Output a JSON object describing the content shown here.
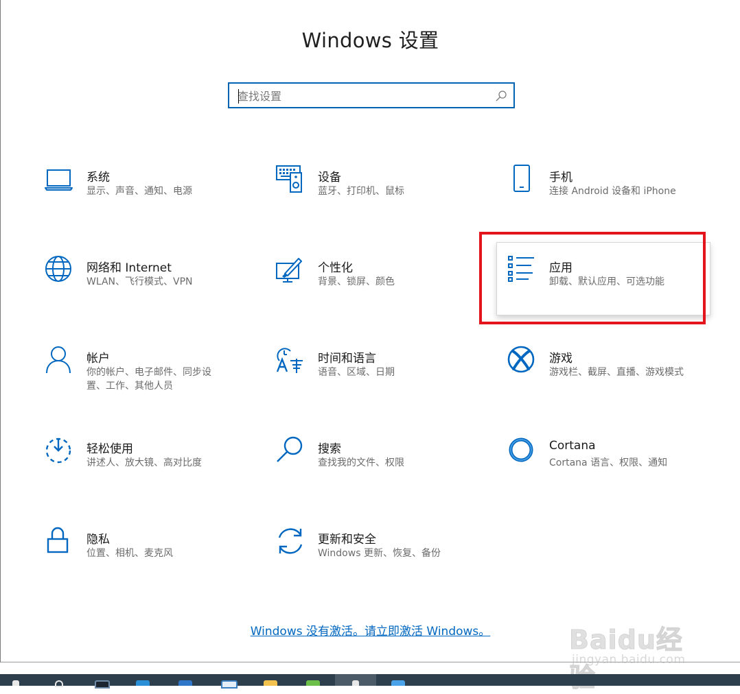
{
  "window": {
    "title": "Windows 设置"
  },
  "search": {
    "placeholder": "查找设置"
  },
  "colors": {
    "accent": "#0063b1",
    "icon": "#0067c0",
    "highlight_box": "#e3141b",
    "taskbar": "#2d3e4c"
  },
  "categories": [
    {
      "name": "系统",
      "desc": "显示、声音、通知、电源",
      "icon": "laptop-icon"
    },
    {
      "name": "设备",
      "desc": "蓝牙、打印机、鼠标",
      "icon": "devices-icon"
    },
    {
      "name": "手机",
      "desc": "连接 Android 设备和 iPhone",
      "icon": "phone-icon"
    },
    {
      "name": "网络和 Internet",
      "desc": "WLAN、飞行模式、VPN",
      "icon": "globe-icon"
    },
    {
      "name": "个性化",
      "desc": "背景、锁屏、颜色",
      "icon": "personalization-icon"
    },
    {
      "name": "应用",
      "desc": "卸载、默认应用、可选功能",
      "icon": "apps-list-icon"
    },
    {
      "name": "帐户",
      "desc": "你的帐户、电子邮件、同步设置、工作、其他人员",
      "icon": "person-icon"
    },
    {
      "name": "时间和语言",
      "desc": "语音、区域、日期",
      "icon": "time-language-icon"
    },
    {
      "name": "游戏",
      "desc": "游戏栏、截屏、直播、游戏模式",
      "icon": "xbox-icon"
    },
    {
      "name": "轻松使用",
      "desc": "讲述人、放大镜、高对比度",
      "icon": "ease-of-access-icon"
    },
    {
      "name": "搜索",
      "desc": "查找我的文件、权限",
      "icon": "search-magnifier-icon"
    },
    {
      "name": "Cortana",
      "desc": "Cortana 语言、权限、通知",
      "icon": "cortana-ring-icon"
    },
    {
      "name": "隐私",
      "desc": "位置、相机、麦克风",
      "icon": "lock-icon"
    },
    {
      "name": "更新和安全",
      "desc": "Windows 更新、恢复、备份",
      "icon": "update-sync-icon"
    }
  ],
  "activation_link": "Windows 没有激活。请立即激活 Windows。",
  "watermark": {
    "logo": "Baidu经验",
    "url": "jingyan.baidu.com"
  }
}
